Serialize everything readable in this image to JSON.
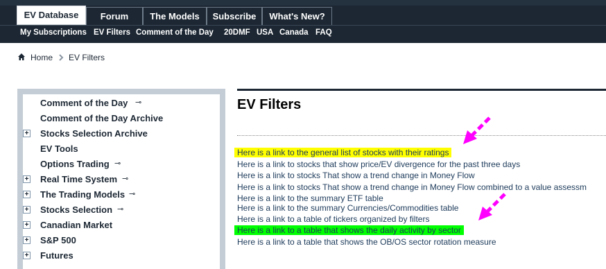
{
  "top_tabs": [
    "EV Database",
    "Forum",
    "The Models",
    "Subscribe",
    "What's New?"
  ],
  "sub_nav": [
    "My Subscriptions",
    "EV Filters",
    "Comment of the Day",
    "20DMF",
    "USA",
    "Canada",
    "FAQ"
  ],
  "breadcrumb": {
    "home": "Home",
    "current": "EV Filters"
  },
  "sidebar": {
    "items": [
      {
        "label": "Comment of the Day",
        "expandable": false,
        "locked": true
      },
      {
        "label": "Comment of the Day Archive",
        "expandable": false,
        "locked": false
      },
      {
        "label": "Stocks Selection Archive",
        "expandable": true,
        "locked": false
      },
      {
        "label": "EV Tools",
        "expandable": false,
        "locked": false
      },
      {
        "label": "Options Trading",
        "expandable": false,
        "locked": true
      },
      {
        "label": "Real Time System",
        "expandable": true,
        "locked": true
      },
      {
        "label": "The Trading Models",
        "expandable": true,
        "locked": true
      },
      {
        "label": "Stocks Selection",
        "expandable": true,
        "locked": true
      },
      {
        "label": "Canadian Market",
        "expandable": true,
        "locked": false
      },
      {
        "label": "S&P 500",
        "expandable": true,
        "locked": false
      },
      {
        "label": "Futures",
        "expandable": true,
        "locked": false
      }
    ]
  },
  "main": {
    "title": "EV Filters",
    "links": [
      "Here is a link to the general list of stocks with their ratings",
      "Here is a link to stocks that show price/EV divergence for the past three days",
      "Here is a link to stocks That show a trend change in Money Flow",
      "Here is a link to stocks That show a trend change in Money Flow combined to a value assessm",
      "Here is a link to the summary ETF table",
      "Here is a link to the summary Currencies/Commodities table",
      "Here is a link to a table of tickers organized by filters",
      "Here is a link to a table that shows the daily activity by sector",
      "Here is a link to a table that shows the OB/OS sector rotation measure"
    ]
  },
  "colors": {
    "nav_bg": "#1c2733",
    "highlight_yellow": "#ffff00",
    "highlight_green": "#00ff00",
    "annotation_arrow": "#ff00ff"
  },
  "icons": {
    "home": "home-icon",
    "breadcrumb_separator": "chevron-right-icon",
    "plus": "plus-icon",
    "key": "key-icon",
    "annotation": "arrow-annotation-icon"
  }
}
